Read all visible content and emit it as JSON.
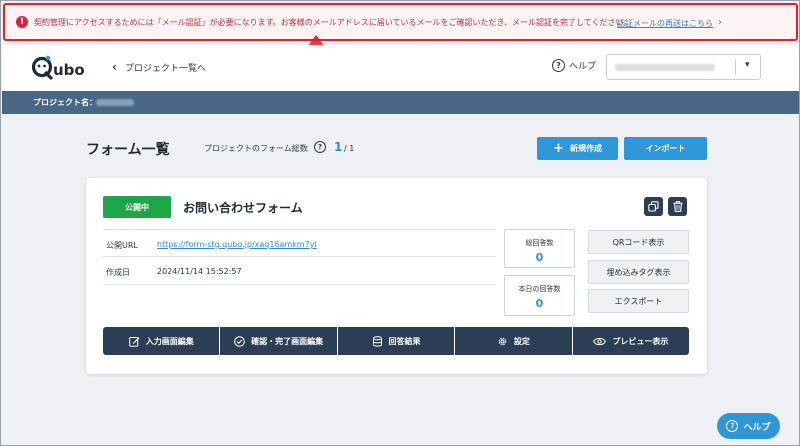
{
  "alert": {
    "message": "契約管理にアクセスするためには「メール認証」が必要になります。お客様のメールアドレスに届いているメールをご確認いただき、メール認証を完了してください。",
    "resend_link": "認証メールの再送はこちら",
    "chevron": "›"
  },
  "header": {
    "back_label": "プロジェクト一覧へ",
    "help_label": "ヘルプ",
    "logo_text": "Qubo"
  },
  "project_bar": {
    "label": "プロジェクト名："
  },
  "toolbar": {
    "page_title": "フォーム一覧",
    "total_label": "プロジェクトのフォーム総数",
    "total_count": "1",
    "total_of": "/ 1",
    "new_button": "新規作成",
    "import_button": "インポート"
  },
  "form_card": {
    "status_badge": "公開中",
    "title": "お問い合わせフォーム",
    "public_url_label": "公開URL",
    "public_url": "https://form-stg.qubo.jp/xaq16amkm7yl",
    "created_label": "作成日",
    "created_at": "2024/11/14 15:52:57",
    "total_responses_label": "総回答数",
    "total_responses": "0",
    "today_responses_label": "本日の回答数",
    "today_responses": "0",
    "qr_button": "QRコード表示",
    "embed_button": "埋め込みタグ表示",
    "export_button": "エクスポート",
    "actions": {
      "input_edit": "入力画面編集",
      "confirm_edit": "確認・完了画面編集",
      "results": "回答結果",
      "settings": "設定",
      "preview": "プレビュー表示"
    }
  },
  "fab": {
    "label": "ヘルプ"
  },
  "colors": {
    "alert_border": "#e2202c",
    "primary": "#2f97d8",
    "navy": "#2c3e55",
    "project_bar": "#4a6685",
    "published": "#1ea548"
  }
}
